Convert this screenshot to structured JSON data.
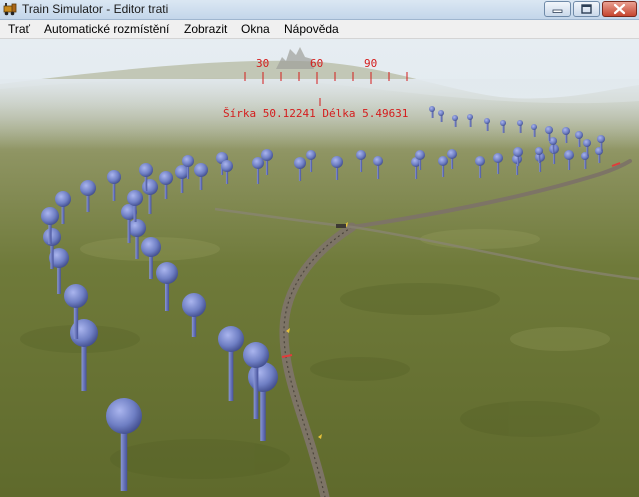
{
  "window": {
    "title": "Train Simulator - Editor trati",
    "controls": [
      "minimize",
      "maximize",
      "close"
    ]
  },
  "menu": {
    "items": [
      {
        "label": "Trať"
      },
      {
        "label": "Automatické rozmístění"
      },
      {
        "label": "Zobrazit"
      },
      {
        "label": "Okna"
      },
      {
        "label": "Nápověda"
      }
    ]
  },
  "compass": {
    "labels": [
      "30",
      "60",
      "90"
    ],
    "position_text": "Šírka 50.12241 Délka 5.49631"
  },
  "icons": {
    "app": "train-simulator-icon",
    "minimize": "minimize-icon",
    "maximize": "maximize-icon",
    "close": "close-icon"
  },
  "colors": {
    "hud": "#d41c1c",
    "marker": "#6f7fc4",
    "terrain": "#6f7a3a",
    "sky": "#dfe8ee"
  }
}
